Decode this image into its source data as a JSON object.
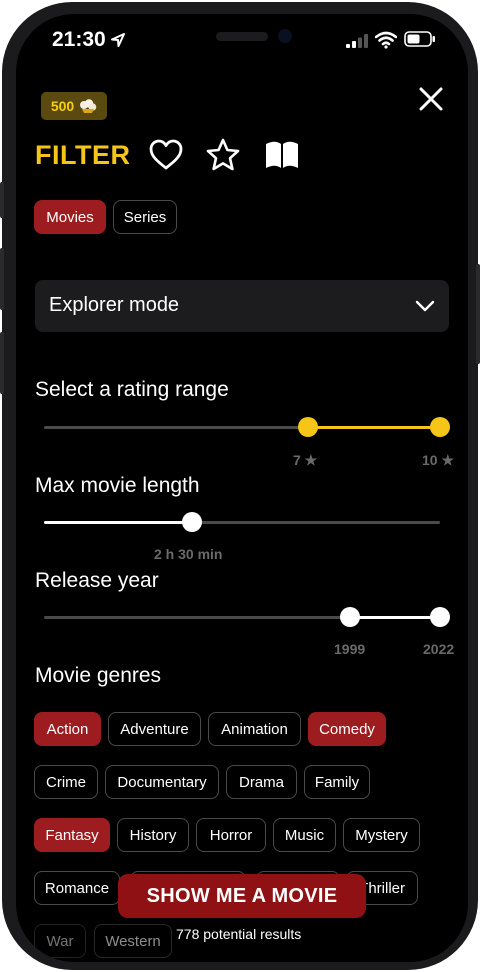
{
  "status_bar": {
    "time": "21:30"
  },
  "coins": {
    "count": "500"
  },
  "header": {
    "title": "FILTER"
  },
  "type_tabs": [
    {
      "label": "Movies",
      "active": true
    },
    {
      "label": "Series",
      "active": false
    }
  ],
  "mode_dropdown": {
    "value": "Explorer mode"
  },
  "rating": {
    "title": "Select a rating range",
    "min": 7,
    "max": 10,
    "min_label": "7 ★",
    "max_label": "10 ★"
  },
  "length": {
    "title": "Max movie length",
    "value_label": "2 h 30 min"
  },
  "year": {
    "title": "Release year",
    "min_label": "1999",
    "max_label": "2022"
  },
  "genres": {
    "title": "Movie genres",
    "items": [
      {
        "label": "Action",
        "active": true
      },
      {
        "label": "Adventure",
        "active": false
      },
      {
        "label": "Animation",
        "active": false
      },
      {
        "label": "Comedy",
        "active": true
      },
      {
        "label": "Crime",
        "active": false
      },
      {
        "label": "Documentary",
        "active": false
      },
      {
        "label": "Drama",
        "active": false
      },
      {
        "label": "Family",
        "active": false
      },
      {
        "label": "Fantasy",
        "active": true
      },
      {
        "label": "History",
        "active": false
      },
      {
        "label": "Horror",
        "active": false
      },
      {
        "label": "Music",
        "active": false
      },
      {
        "label": "Mystery",
        "active": false
      },
      {
        "label": "Romance",
        "active": false
      },
      {
        "label": "Thriller",
        "active": false
      },
      {
        "label": "War",
        "active": false
      },
      {
        "label": "Western",
        "active": false
      }
    ]
  },
  "cta": {
    "label": "SHOW ME A MOVIE",
    "results": "778 potential results"
  },
  "colors": {
    "accent_yellow": "#f5c518",
    "active_red": "#9c1c1f",
    "cta_red": "#8f1114"
  },
  "icons": [
    "location-arrow-icon",
    "signal-icon",
    "wifi-icon",
    "battery-icon",
    "close-icon",
    "heart-icon",
    "star-icon",
    "book-icon",
    "chevron-down-icon",
    "popcorn-icon"
  ]
}
